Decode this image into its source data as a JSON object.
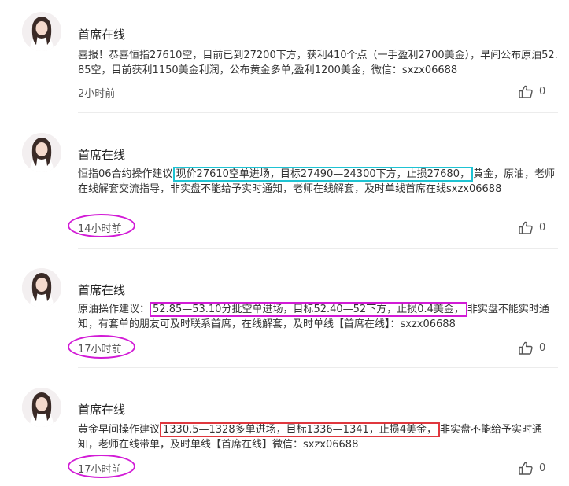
{
  "posts": [
    {
      "author": "首席在线",
      "content_pre": "喜报！恭喜恒指27610空，目前已到27200下方，获利410个点（一手盈利2700美金），早间公布原油52.85空，目前获利1150美金利润，公布黄金多单,盈利1200美金，微信：sxzx06688",
      "content_hl": "",
      "content_post": "",
      "time": "2小时前",
      "likes": "0"
    },
    {
      "author": "首席在线",
      "content_pre": "恒指06合约操作建议",
      "content_hl": "现价27610空单进场，目标27490—24300下方，止损27680，",
      "content_post": "黄金，原油，老师在线解套交流指导，非实盘不能给予实时通知，老师在线解套，及时单线首席在线sxzx06688",
      "time": "14小时前",
      "likes": "0"
    },
    {
      "author": "首席在线",
      "content_pre": "原油操作建议：",
      "content_hl": "52.85—53.10分批空单进场，目标52.40—52下方，止损0.4美金，",
      "content_post": "非实盘不能实时通知，有套单的朋友可及时联系首席，在线解套，及时单线【首席在线】：sxzx06688",
      "time": "17小时前",
      "likes": "0"
    },
    {
      "author": "首席在线",
      "content_pre": "黄金早间操作建议",
      "content_hl": "1330.5—1328多单进场，目标1336—1341，止损4美金，",
      "content_post": "非实盘不能给予实时通知，老师在线带单，及时单线【首席在线】微信：sxzx06688",
      "time": "17小时前",
      "likes": "0"
    }
  ],
  "colors": {
    "highlight_cyan": "#1ec3d3",
    "highlight_magenta": "#d21bd6",
    "highlight_red": "#e0373e"
  },
  "icons": {
    "avatar": "avatar-photo",
    "like": "thumbs-up-icon"
  }
}
